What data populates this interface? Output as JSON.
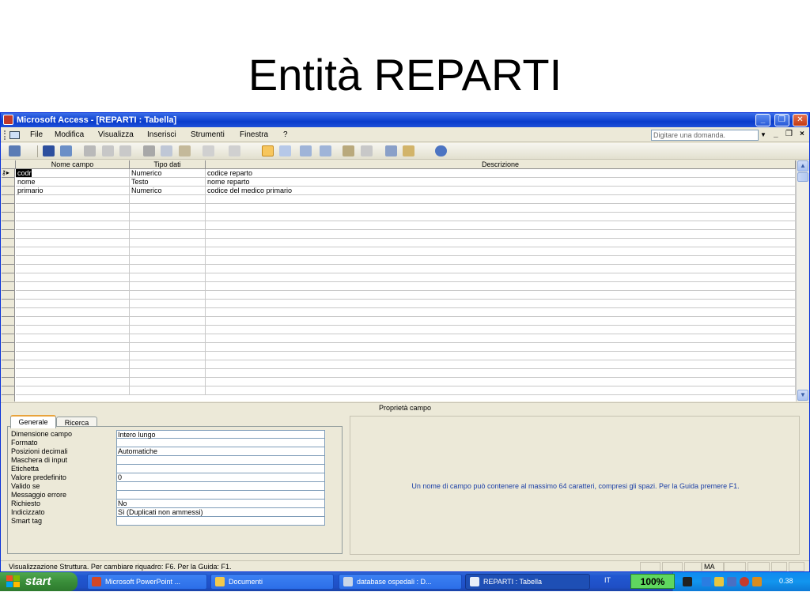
{
  "slide": {
    "title": "Entità REPARTI"
  },
  "window": {
    "title": "Microsoft Access - [REPARTI : Tabella]"
  },
  "menu": {
    "items": [
      "File",
      "Modifica",
      "Visualizza",
      "Inserisci",
      "Strumenti",
      "Finestra",
      "?"
    ],
    "help_placeholder": "Digitare una domanda."
  },
  "grid": {
    "columns": [
      "Nome campo",
      "Tipo dati",
      "Descrizione"
    ],
    "rows": [
      {
        "name": "codr",
        "type": "Numerico",
        "description": "codice reparto",
        "primary_key": true
      },
      {
        "name": "nome",
        "type": "Testo",
        "description": "nome reparto"
      },
      {
        "name": "primario",
        "type": "Numerico",
        "description": "codice del medico primario"
      }
    ]
  },
  "properties": {
    "section_title": "Proprietà campo",
    "tabs": [
      "Generale",
      "Ricerca"
    ],
    "active_tab": "Generale",
    "fields": [
      {
        "label": "Dimensione campo",
        "value": "Intero lungo"
      },
      {
        "label": "Formato",
        "value": ""
      },
      {
        "label": "Posizioni decimali",
        "value": "Automatiche"
      },
      {
        "label": "Maschera di input",
        "value": ""
      },
      {
        "label": "Etichetta",
        "value": ""
      },
      {
        "label": "Valore predefinito",
        "value": "0"
      },
      {
        "label": "Valido se",
        "value": ""
      },
      {
        "label": "Messaggio errore",
        "value": ""
      },
      {
        "label": "Richiesto",
        "value": "No"
      },
      {
        "label": "Indicizzato",
        "value": "Sì (Duplicati non ammessi)"
      },
      {
        "label": "Smart tag",
        "value": ""
      }
    ],
    "hint": "Un nome di campo può contenere al massimo 64 caratteri, compresi gli spazi. Per la Guida premere F1."
  },
  "status": {
    "text": "Visualizzazione Struttura. Per cambiare riquadro: F6. Per la Guida: F1.",
    "indicator": "MA"
  },
  "taskbar": {
    "start_label": "start",
    "tasks": [
      {
        "label": "Microsoft PowerPoint ...",
        "icon": "powerpoint-icon",
        "color": "#d24726"
      },
      {
        "label": "Documenti",
        "icon": "folder-icon",
        "color": "#f2c94c"
      },
      {
        "label": "database ospedali : D...",
        "icon": "database-icon",
        "color": "#c9d6e8"
      },
      {
        "label": "REPARTI : Tabella",
        "icon": "table-icon",
        "color": "#e8eef8",
        "active": true
      }
    ],
    "language": "IT",
    "zoom": "100%",
    "clock": "0.38"
  }
}
